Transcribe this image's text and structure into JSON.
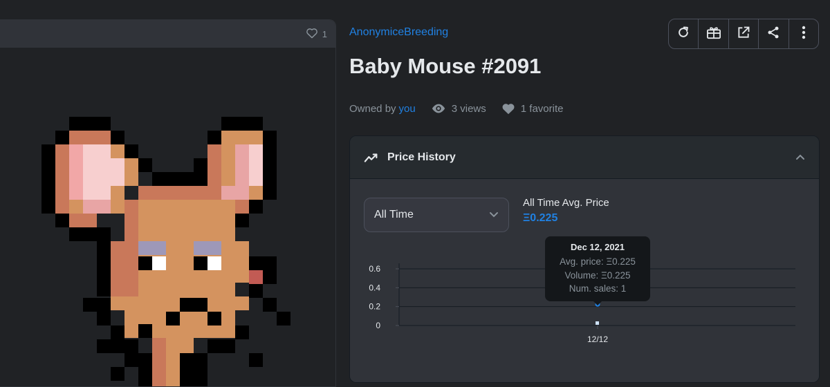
{
  "image_panel": {
    "favorite_count": "1"
  },
  "collection_name": "AnonymiceBreeding",
  "item_title": "Baby Mouse #2091",
  "meta": {
    "owned_by_label": "Owned by",
    "owner": "you",
    "views": "3 views",
    "favorites": "1 favorite"
  },
  "toolbar": {
    "icons": [
      "refresh-icon",
      "gift-icon",
      "external-link-icon",
      "share-icon",
      "more-icon"
    ]
  },
  "price_history": {
    "title": "Price History",
    "period_select": "All Time",
    "avg_label": "All Time Avg. Price",
    "avg_value": "Ξ0.225",
    "tooltip": {
      "date": "Dec 12, 2021",
      "avg_price": "Avg. price: Ξ0.225",
      "volume": "Volume: Ξ0.225",
      "num_sales": "Num. sales: 1"
    }
  },
  "chart_data": {
    "type": "line",
    "x": [
      "12/12"
    ],
    "series": [
      {
        "values": [
          0.225
        ]
      }
    ],
    "y_ticks": [
      "0.6",
      "0.4",
      "0.2",
      "0"
    ],
    "ylim": [
      0,
      0.6
    ],
    "grid": true
  },
  "colors": {
    "accent": "#2081e2",
    "background": "#202225",
    "card": "#303339"
  }
}
